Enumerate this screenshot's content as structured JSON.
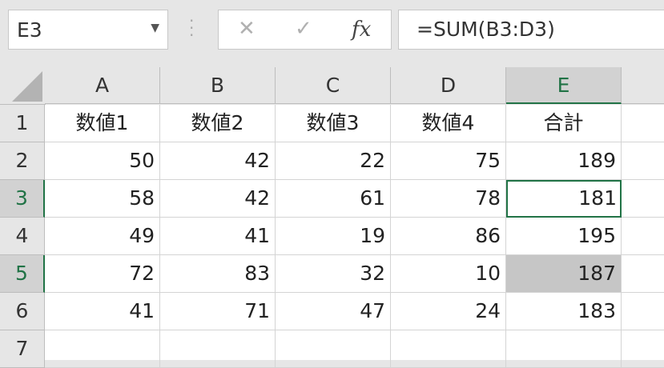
{
  "name_box": {
    "value": "E3",
    "dropdown_icon": "caret-down-icon"
  },
  "formula_bar": {
    "cancel_icon": "✕",
    "enter_icon": "✓",
    "fx_label": "fx",
    "formula": "=SUM(B3:D3)"
  },
  "columns": [
    "A",
    "B",
    "C",
    "D",
    "E"
  ],
  "selected_column": "E",
  "rows": [
    {
      "num": "1",
      "cells": [
        "数値1",
        "数値2",
        "数値3",
        "数値4",
        "合計"
      ]
    },
    {
      "num": "2",
      "cells": [
        "50",
        "42",
        "22",
        "75",
        "189"
      ]
    },
    {
      "num": "3",
      "cells": [
        "58",
        "42",
        "61",
        "78",
        "181"
      ]
    },
    {
      "num": "4",
      "cells": [
        "49",
        "41",
        "19",
        "86",
        "195"
      ]
    },
    {
      "num": "5",
      "cells": [
        "72",
        "83",
        "32",
        "10",
        "187"
      ]
    },
    {
      "num": "6",
      "cells": [
        "41",
        "71",
        "47",
        "24",
        "183"
      ]
    },
    {
      "num": "7",
      "cells": [
        "",
        "",
        "",
        "",
        ""
      ]
    }
  ],
  "active_cell": "E3",
  "highlighted_cell": "E5",
  "selected_rows": [
    "3",
    "5"
  ],
  "colors": {
    "accent": "#217346",
    "highlight": "#c6c6c6"
  }
}
